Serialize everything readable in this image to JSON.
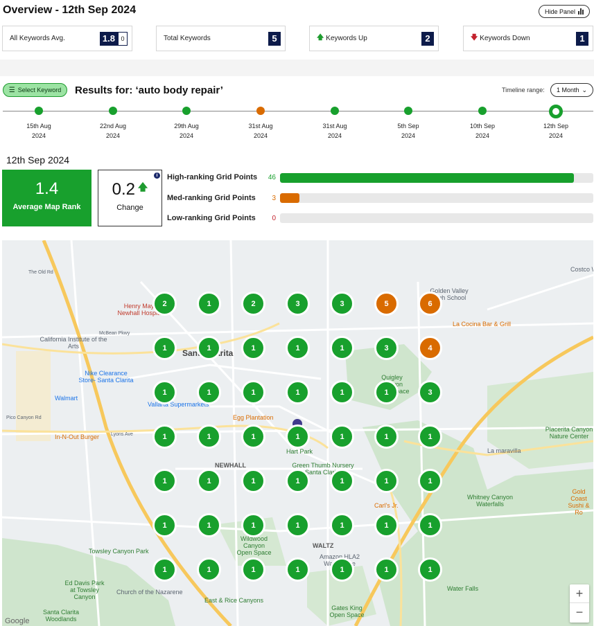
{
  "header": {
    "title": "Overview - 12th Sep 2024",
    "hide_panel_label": "Hide Panel"
  },
  "stats": [
    {
      "label": "All Keywords Avg.",
      "value": "1.8",
      "sub": "0",
      "arrow": ""
    },
    {
      "label": "Total Keywords",
      "value": "5",
      "sub": "",
      "arrow": ""
    },
    {
      "label": "Keywords Up",
      "value": "2",
      "sub": "",
      "arrow": "up"
    },
    {
      "label": "Keywords Down",
      "value": "1",
      "sub": "",
      "arrow": "down"
    }
  ],
  "toolbar": {
    "select_keyword_label": "Select Keyword",
    "results_label": "Results for: ‘auto body repair’",
    "timeline_range_label": "Timeline range:",
    "timeline_range_value": "1 Month"
  },
  "timeline": [
    {
      "date": "15th Aug",
      "year": "2024",
      "status": "green"
    },
    {
      "date": "22nd Aug",
      "year": "2024",
      "status": "green"
    },
    {
      "date": "29th Aug",
      "year": "2024",
      "status": "green"
    },
    {
      "date": "31st Aug",
      "year": "2024",
      "status": "orange"
    },
    {
      "date": "31st Aug",
      "year": "2024",
      "status": "green"
    },
    {
      "date": "5th Sep",
      "year": "2024",
      "status": "green"
    },
    {
      "date": "10th Sep",
      "year": "2024",
      "status": "green"
    },
    {
      "date": "12th Sep",
      "year": "2024",
      "status": "selected"
    }
  ],
  "summary": {
    "date": "12th Sep 2024",
    "avg_rank": "1.4",
    "avg_rank_label": "Average Map Rank",
    "change": "0.2",
    "change_label": "Change"
  },
  "ranking": [
    {
      "label": "High-ranking Grid Points",
      "count": "46",
      "fraction": 0.939,
      "color": "#18a02d"
    },
    {
      "label": "Med-ranking Grid Points",
      "count": "3",
      "fraction": 0.061,
      "color": "#d96b00"
    },
    {
      "label": "Low-ranking Grid Points",
      "count": "0",
      "fraction": 0,
      "color": "#c3222d"
    }
  ],
  "colors": {
    "green": "#18a02d",
    "orange": "#d96b00",
    "navy": "#0d1b4a"
  },
  "grid": [
    [
      "2",
      "1",
      "2",
      "3",
      "3",
      "5",
      "6"
    ],
    [
      "1",
      "1",
      "1",
      "1",
      "1",
      "3",
      "4"
    ],
    [
      "1",
      "1",
      "1",
      "1",
      "1",
      "1",
      "3"
    ],
    [
      "1",
      "1",
      "1",
      "1",
      "1",
      "1",
      "1"
    ],
    [
      "1",
      "1",
      "1",
      "1",
      "1",
      "1",
      "1"
    ],
    [
      "1",
      "1",
      "1",
      "1",
      "1",
      "1",
      "1"
    ],
    [
      "1",
      "1",
      "1",
      "1",
      "1",
      "1",
      "1"
    ]
  ],
  "map_labels": [
    "Santa Clarita",
    "Henry Mayo Newhall Hospital",
    "California Institute of the Arts",
    "Nike Clearance Store- Santa Clarita",
    "Walmart",
    "Vallarta Supermarkets",
    "Egg Plantation",
    "In-N-Out Burger",
    "NEWHALL",
    "Hart Park",
    "Green Thumb Nursery Santa Clarita",
    "Golden Valley High School",
    "La Cocina Bar & Grill",
    "Quigley Canyon Open Space",
    "Placerita Canyon Nature Center",
    "La maravilla",
    "Whitney Canyon Waterfalls",
    "Gold Coast Sushi & Ro",
    "Carl's Jr.",
    "Wildwood Canyon Open Space",
    "WALTZ",
    "Amazon HLA2 Warehouse",
    "Towsley Canyon Park",
    "Ed Davis Park at Towsley Canyon",
    "Church of the Nazarene",
    "East & Rice Canyons",
    "Water Falls",
    "Gates King Open Space",
    "Santa Clarita Woodlands",
    "Costco W",
    "McBean Pkwy",
    "Lyons Ave",
    "Pico Canyon Rd",
    "The Old Rd",
    "Google"
  ],
  "map_controls": {
    "zoom_in": "+",
    "zoom_out": "−"
  }
}
